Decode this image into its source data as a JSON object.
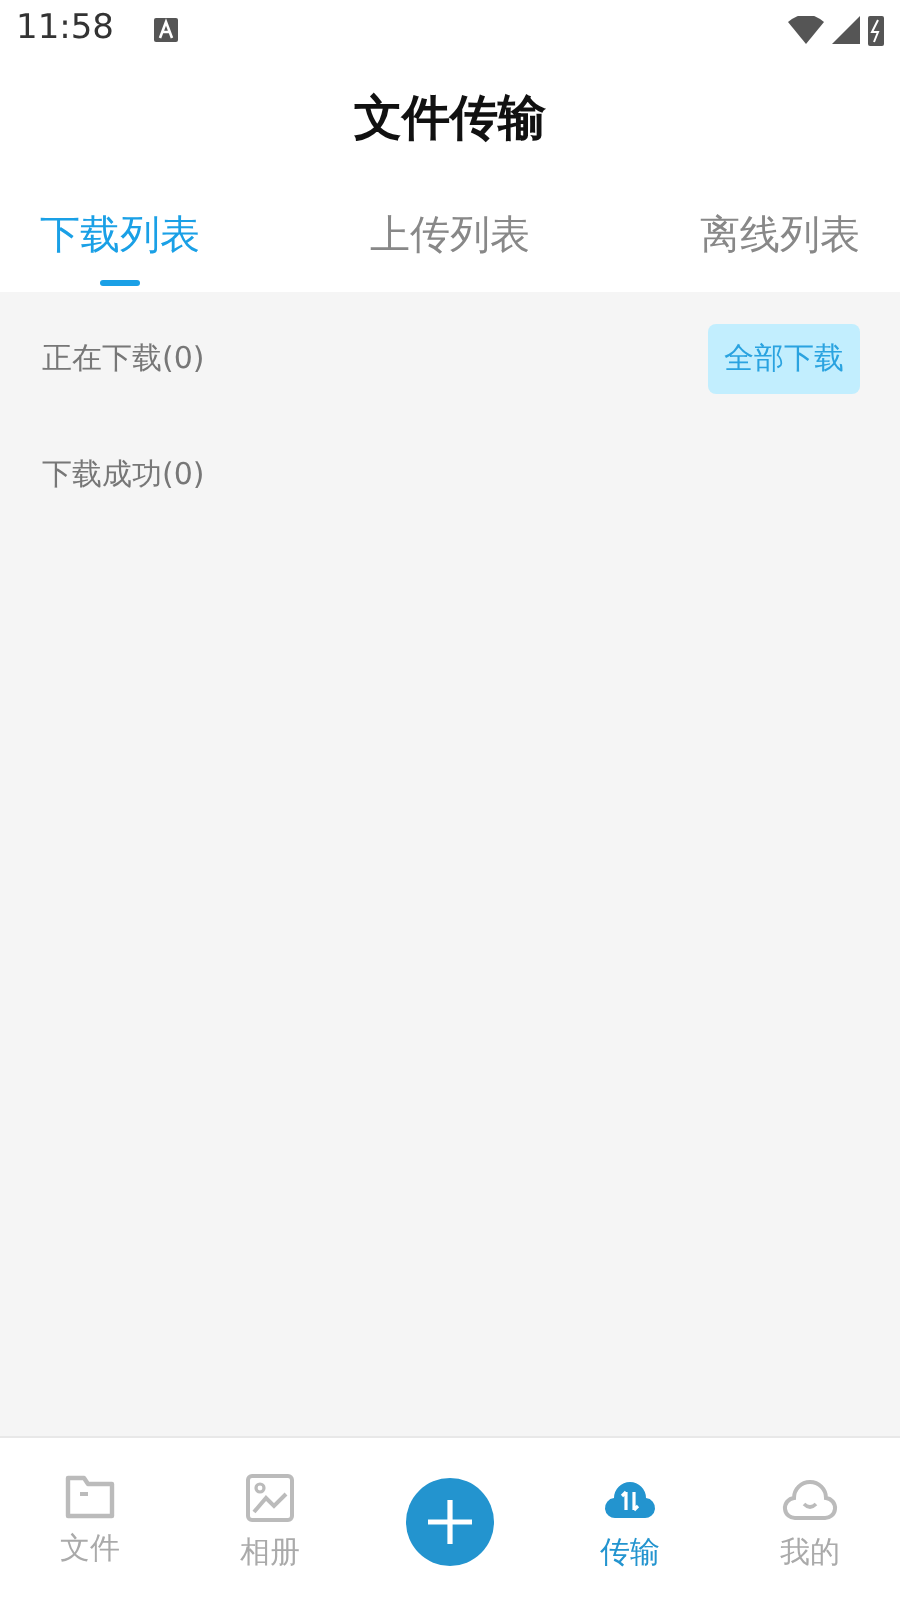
{
  "status_bar": {
    "time": "11:58"
  },
  "header": {
    "title": "文件传输"
  },
  "tabs": [
    {
      "label": "下载列表",
      "selected": true
    },
    {
      "label": "上传列表",
      "selected": false
    },
    {
      "label": "离线列表",
      "selected": false
    }
  ],
  "sections": [
    {
      "label": "正在下载(0)",
      "action": "全部下载"
    },
    {
      "label": "下载成功(0)"
    }
  ],
  "bottom_nav": [
    {
      "kind": "folder",
      "label": "文件",
      "selected": false
    },
    {
      "kind": "photo",
      "label": "相册",
      "selected": false
    },
    {
      "kind": "add"
    },
    {
      "kind": "cloud",
      "label": "传输",
      "selected": true
    },
    {
      "kind": "face",
      "label": "我的",
      "selected": false
    }
  ]
}
